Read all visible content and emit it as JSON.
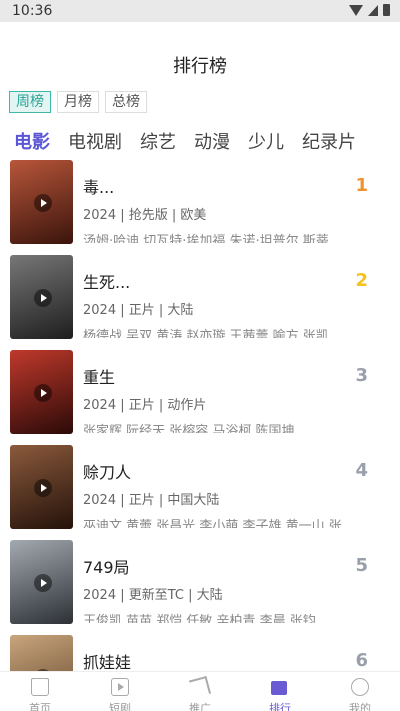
{
  "status_bar": {
    "time": "10:36"
  },
  "header": {
    "title": "排行榜"
  },
  "period_tabs": [
    {
      "label": "周榜",
      "active": true
    },
    {
      "label": "月榜",
      "active": false
    },
    {
      "label": "总榜",
      "active": false
    }
  ],
  "category_tabs": [
    {
      "label": "电影",
      "active": true
    },
    {
      "label": "电视剧",
      "active": false
    },
    {
      "label": "综艺",
      "active": false
    },
    {
      "label": "动漫",
      "active": false
    },
    {
      "label": "少儿",
      "active": false
    },
    {
      "label": "纪录片",
      "active": false
    }
  ],
  "items": [
    {
      "title": "毒...",
      "meta": "2024 | 抢先版 | 欧美",
      "cast": "汤姆·哈迪 切瓦特·埃加福 朱诺·坦普尔 斯蒂",
      "rank": "1",
      "poster_color": "#6b2a1a"
    },
    {
      "title": "生死...",
      "meta": "2024 | 正片 | 大陆",
      "cast": "杨德战 吴双 黄涛 赵亦璇 王茜蕾 喻方 张凯",
      "rank": "2",
      "poster_color": "#3a3a3a"
    },
    {
      "title": "重生",
      "meta": "2024 | 正片 | 动作片",
      "cast": "张家辉 阮经天 张榕容 马浴柯 陈国坤",
      "rank": "3",
      "poster_color": "#7a1d16"
    },
    {
      "title": "赊刀人",
      "meta": "2024 | 正片 | 中国大陆",
      "cast": "巫迪文 黄蕾 张昌光 李小萌 李子雄 黄一山 张",
      "rank": "4",
      "poster_color": "#4d2b1e"
    },
    {
      "title": "749局",
      "meta": "2024 | 更新至TC | 大陆",
      "cast": "王俊凯 苗苗 郑恺 任敏 辛柏青 李晨 张钧",
      "rank": "5",
      "poster_color": "#5a5f66"
    },
    {
      "title": "抓娃娃",
      "meta": "",
      "cast": "",
      "rank": "6",
      "poster_color": "#8a6a4a"
    }
  ],
  "tab_bar": [
    {
      "label": "首页",
      "icon": "home-icon",
      "active": false
    },
    {
      "label": "短剧",
      "icon": "video-icon",
      "active": false
    },
    {
      "label": "推广",
      "icon": "send-icon",
      "active": false
    },
    {
      "label": "排行",
      "icon": "ranking-icon",
      "active": true
    },
    {
      "label": "我的",
      "icon": "user-icon",
      "active": false
    }
  ],
  "colors": {
    "accent": "#5b56d6",
    "period_active": "#2aa596",
    "rank_1": "#f0922d",
    "rank_2": "#f5c21b",
    "rank_other": "#9aa0ab"
  }
}
